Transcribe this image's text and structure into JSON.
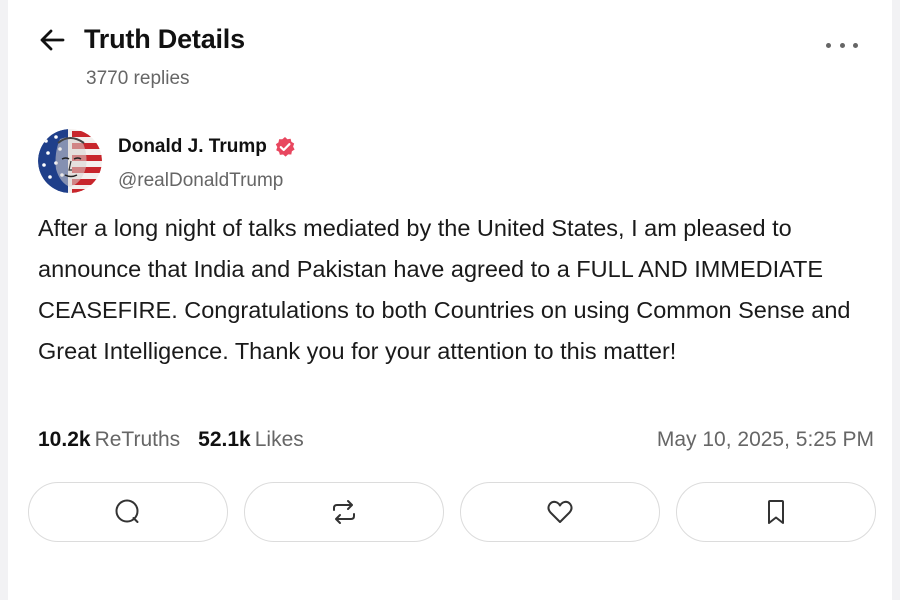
{
  "header": {
    "title": "Truth Details",
    "replies": "3770 replies",
    "back_icon": "back-arrow-icon",
    "more_icon": "more-horizontal-icon"
  },
  "author": {
    "name": "Donald J. Trump",
    "handle": "@realDonaldTrump",
    "verified": true,
    "verified_color": "#e8475f"
  },
  "post": {
    "text": "After a long night of talks mediated by the United States, I am pleased to announce that India and Pakistan have agreed to a FULL AND IMMEDIATE CEASEFIRE. Congratulations to both Countries on using Common Sense and Great Intelligence. Thank you for your attention to this matter!"
  },
  "stats": {
    "retruths_count": "10.2k",
    "retruths_label": "ReTruths",
    "likes_count": "52.1k",
    "likes_label": "Likes",
    "timestamp": "May 10, 2025, 5:25 PM"
  },
  "actions": [
    {
      "name": "reply",
      "icon": "comment-icon"
    },
    {
      "name": "retruth",
      "icon": "repost-icon"
    },
    {
      "name": "like",
      "icon": "heart-icon"
    },
    {
      "name": "bookmark",
      "icon": "bookmark-icon"
    }
  ]
}
